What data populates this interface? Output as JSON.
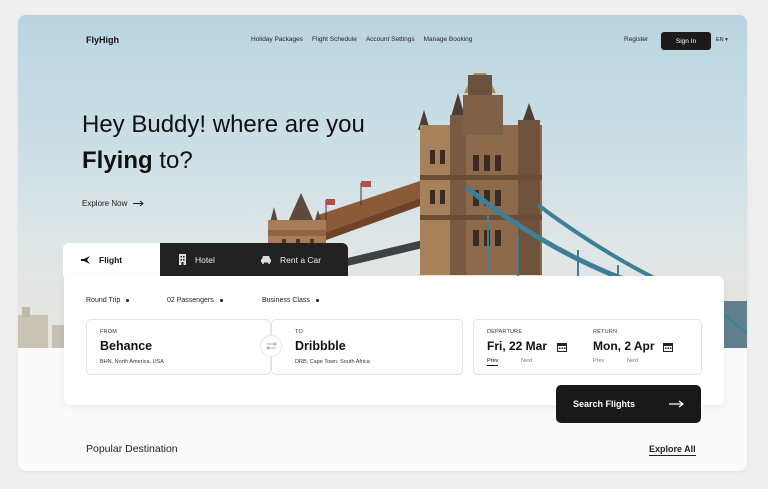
{
  "nav": {
    "logo": "FlyHigh",
    "links": [
      "Holiday Packages",
      "Flight Schedule",
      "Account Settings",
      "Manage Booking"
    ],
    "register": "Register",
    "sign_in": "Sign In",
    "language": "EN ▾"
  },
  "hero": {
    "line1": "Hey Buddy! where are you",
    "line2_bold": "Flying",
    "line2_rest": " to?",
    "explore": "Explore Now"
  },
  "tabs": [
    "Flight",
    "Hotel",
    "Rent a Car"
  ],
  "options": {
    "trip": "Round Trip",
    "passengers": "02 Passengers",
    "class": "Business Class"
  },
  "from": {
    "label": "FROM",
    "city": "Behance",
    "detail": "BHN, North America, USA"
  },
  "to": {
    "label": "TO",
    "city": "Dribbble",
    "detail": "DRB, Cape Town, South Africa"
  },
  "departure": {
    "label": "DEPARTURE",
    "date": "Fri, 22 Mar",
    "prev": "Prev",
    "next": "Next"
  },
  "return": {
    "label": "RETURN",
    "date": "Mon, 2 Apr",
    "prev": "Prev",
    "next": "Next"
  },
  "search_button": "Search Flights",
  "popular": {
    "title": "Popular Destination",
    "explore_all": "Explore All"
  },
  "icons": [
    "plane-icon",
    "hotel-icon",
    "car-icon",
    "swap-icon",
    "calendar-icon",
    "arrow-right-icon"
  ]
}
